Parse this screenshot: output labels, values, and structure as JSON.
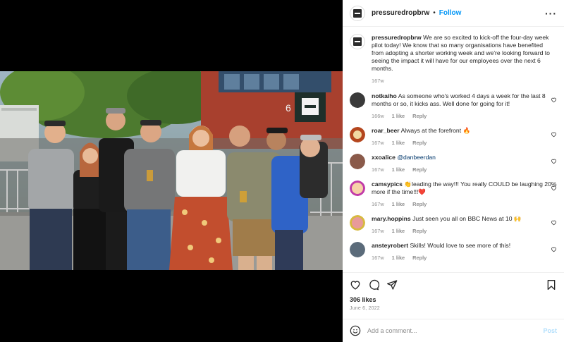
{
  "post": {
    "username": "pressuredropbrw",
    "follow_label": "Follow",
    "more_label": "•••",
    "caption": {
      "username": "pressuredropbrw",
      "text": "We are so excited to kick-off the four-day week pilot today! We know that so many organisations have benefited from adopting a shorter working week and we're looking forward to seeing the impact it will have for our employees over the next 6 months.",
      "age": "167w"
    },
    "comments": [
      {
        "username": "notkaiho",
        "text": "As someone who's worked 4 days a week for the last 8 months or so, it kicks ass. Well done for going for it!",
        "age": "166w",
        "likes": "1 like",
        "reply": "Reply",
        "avatar_color": "#3a3a3a"
      },
      {
        "username": "roar_beer",
        "text": "Always at the forefront 🔥",
        "age": "167w",
        "likes": "1 like",
        "reply": "Reply",
        "avatar_color": "#b4461e"
      },
      {
        "username": "xxoalice",
        "mention": "@danbeerdan",
        "text": "",
        "age": "167w",
        "likes": "1 like",
        "reply": "Reply",
        "avatar_color": "#8a5a4a"
      },
      {
        "username": "camsypics",
        "text": "👏leading the way!!! You really COULD be laughing 20% more if the time!!!❤️",
        "age": "167w",
        "likes": "1 like",
        "reply": "Reply",
        "avatar_color": "#c13aa8"
      },
      {
        "username": "mary.hoppins",
        "text": "Just seen you all on BBC News at 10 🙌",
        "age": "167w",
        "likes": "1 like",
        "reply": "Reply",
        "avatar_color": "#d7b940"
      },
      {
        "username": "ansteyrobert",
        "text": "Skills! Would love to see more of this!",
        "age": "167w",
        "likes": "1 like",
        "reply": "Reply",
        "avatar_color": "#5b6b7a"
      }
    ],
    "likes": "306 likes",
    "date": "June 6, 2022",
    "add_comment_placeholder": "Add a comment...",
    "post_label": "Post",
    "photo_number": "6"
  },
  "colors": {
    "accent": "#0095f6",
    "post_disabled": "#b2dffc",
    "muted": "#8e8e8e"
  }
}
